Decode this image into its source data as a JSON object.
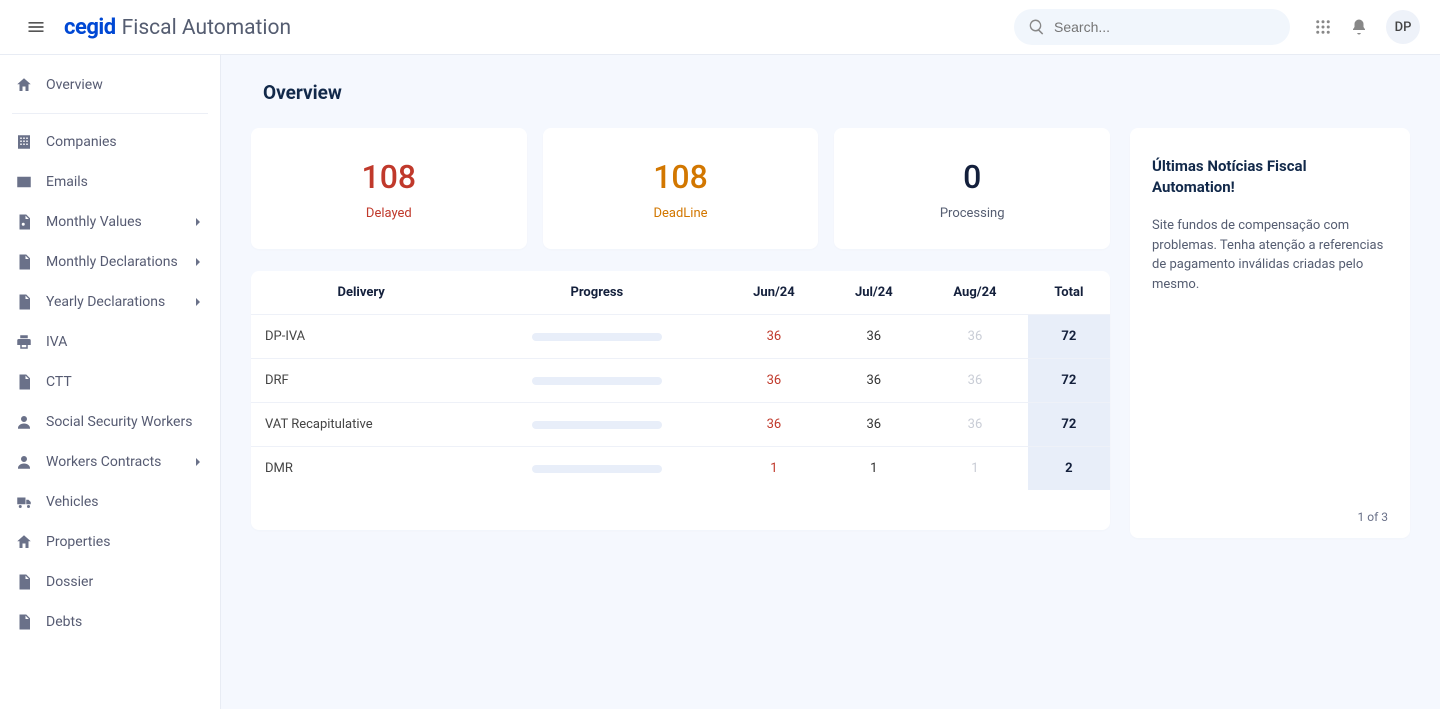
{
  "header": {
    "logo": "cegid",
    "app_title": "Fiscal Automation",
    "search_placeholder": "Search...",
    "avatar_initials": "DP"
  },
  "sidebar": {
    "overview": "Overview",
    "items": [
      {
        "label": "Companies",
        "icon": "building"
      },
      {
        "label": "Emails",
        "icon": "mail"
      },
      {
        "label": "Monthly Values",
        "icon": "doc-config",
        "expandable": true
      },
      {
        "label": "Monthly Declarations",
        "icon": "doc",
        "expandable": true
      },
      {
        "label": "Yearly Declarations",
        "icon": "doc",
        "expandable": true
      },
      {
        "label": "IVA",
        "icon": "print"
      },
      {
        "label": "CTT",
        "icon": "doc"
      },
      {
        "label": "Social Security Workers",
        "icon": "person"
      },
      {
        "label": "Workers Contracts",
        "icon": "person",
        "expandable": true
      },
      {
        "label": "Vehicles",
        "icon": "truck"
      },
      {
        "label": "Properties",
        "icon": "home"
      },
      {
        "label": "Dossier",
        "icon": "doc"
      },
      {
        "label": "Debts",
        "icon": "doc"
      }
    ]
  },
  "main": {
    "page_title": "Overview",
    "stats": [
      {
        "value": "108",
        "label": "Delayed",
        "cls": "c-delayed"
      },
      {
        "value": "108",
        "label": "DeadLine",
        "cls": "c-deadline"
      },
      {
        "value": "0",
        "label": "Processing",
        "cls": "c-processing"
      }
    ],
    "table": {
      "headers": [
        "Delivery",
        "Progress",
        "Jun/24",
        "Jul/24",
        "Aug/24",
        "Total"
      ],
      "rows": [
        {
          "delivery": "DP-IVA",
          "m1": "36",
          "m2": "36",
          "m3": "36",
          "total": "72"
        },
        {
          "delivery": "DRF",
          "m1": "36",
          "m2": "36",
          "m3": "36",
          "total": "72"
        },
        {
          "delivery": "VAT Recapitulative",
          "m1": "36",
          "m2": "36",
          "m3": "36",
          "total": "72"
        },
        {
          "delivery": "DMR",
          "m1": "1",
          "m2": "1",
          "m3": "1",
          "total": "2"
        }
      ]
    },
    "news": {
      "title": "Últimas Notícias Fiscal Automation!",
      "body": "Site fundos de compensação com problemas. Tenha atenção a referencias de pagamento inválidas criadas pelo mesmo.",
      "pager": "1 of 3"
    }
  }
}
